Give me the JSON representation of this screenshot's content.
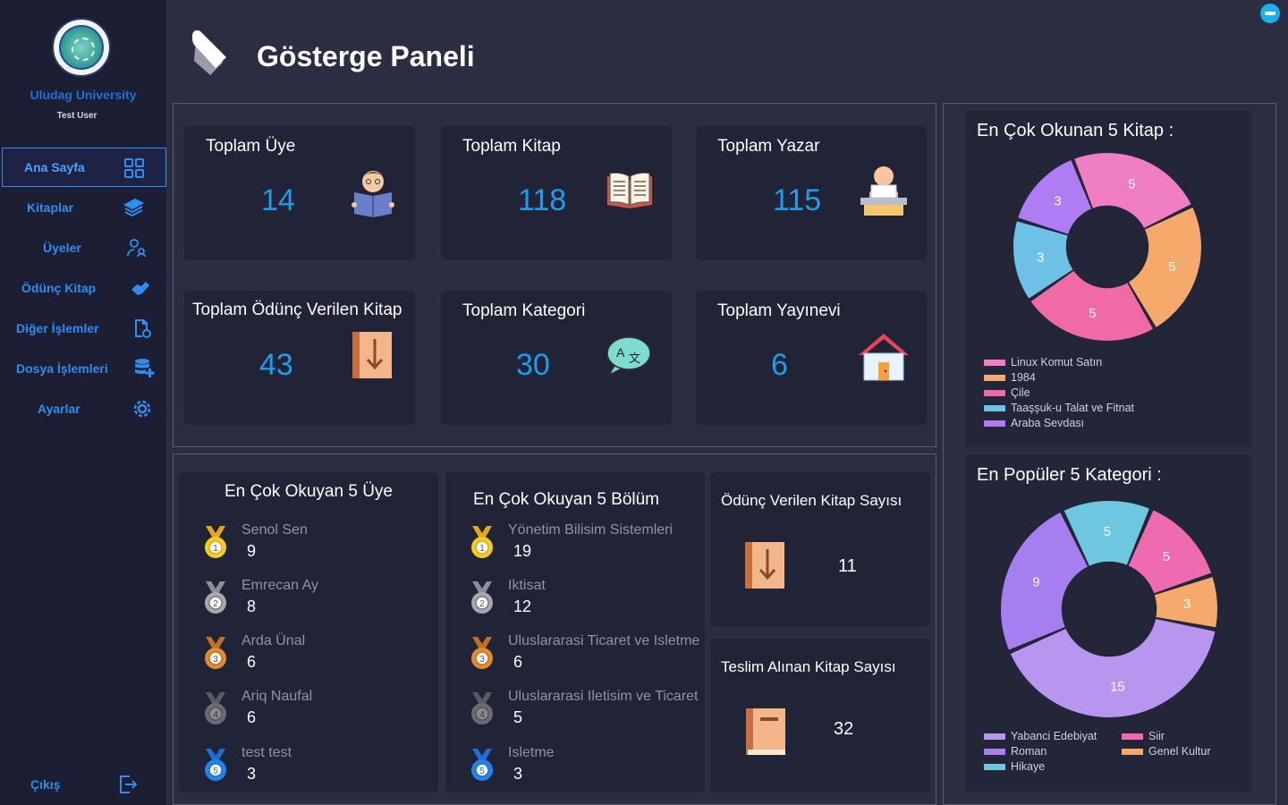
{
  "sidebar": {
    "university": "Uludag University",
    "user": "Test User",
    "items": [
      {
        "label": "Ana Sayfa"
      },
      {
        "label": "Kitaplar"
      },
      {
        "label": "Üyeler"
      },
      {
        "label": "Ödünç Kitap"
      },
      {
        "label": "Diğer İşlemler"
      },
      {
        "label": "Dosya İşlemleri"
      },
      {
        "label": "Ayarlar"
      }
    ],
    "exit_label": "Çıkış"
  },
  "header": {
    "title": "Gösterge Paneli"
  },
  "stats": [
    {
      "title": "Toplam Üye",
      "value": "14",
      "icon": "reader-icon"
    },
    {
      "title": "Toplam Kitap",
      "value": "118",
      "icon": "open-book-icon"
    },
    {
      "title": "Toplam Yazar",
      "value": "115",
      "icon": "writer-icon"
    },
    {
      "title": "Toplam Ödünç Verilen Kitap",
      "value": "43",
      "icon": "download-book-icon"
    },
    {
      "title": "Toplam Kategori",
      "value": "30",
      "icon": "translate-icon"
    },
    {
      "title": "Toplam Yayınevi",
      "value": "6",
      "icon": "house-icon"
    }
  ],
  "top_members": {
    "title": "En Çok Okuyan 5 Üye",
    "items": [
      {
        "name": "Senol Sen",
        "value": "9"
      },
      {
        "name": "Emrecan Ay",
        "value": "8"
      },
      {
        "name": "Arda Ünal",
        "value": "6"
      },
      {
        "name": "Ariq Naufal",
        "value": "6"
      },
      {
        "name": "test test",
        "value": "3"
      }
    ]
  },
  "top_departments": {
    "title": "En Çok Okuyan 5 Bölüm",
    "items": [
      {
        "name": "Yönetim Bilisim Sistemleri",
        "value": "19"
      },
      {
        "name": "Iktisat",
        "value": "12"
      },
      {
        "name": "Uluslararasi Ticaret ve Isletme",
        "value": "6"
      },
      {
        "name": "Uluslararasi Iletisim ve Ticaret",
        "value": "5"
      },
      {
        "name": "Isletme",
        "value": "3"
      }
    ]
  },
  "lent": {
    "title": "Ödünç Verilen Kitap Sayısı",
    "value": "11"
  },
  "returned": {
    "title": "Teslim Alınan Kitap Sayısı",
    "value": "32"
  },
  "colors": {
    "accent": "#1f9bf0",
    "sidebar_bg": "#1c1e33",
    "page_bg": "#2b2e40",
    "card_bg": "#212436"
  },
  "chart_data": [
    {
      "type": "pie",
      "title": "En Çok Okunan 5 Kitap :",
      "labels": [
        "Linux Komut Satın",
        "1984",
        "Çile",
        "Taaşşuk-u Talat ve Fitnat",
        "Araba Sevdası"
      ],
      "values": [
        5,
        5,
        5,
        3,
        3
      ],
      "colors": [
        "#f07ec4",
        "#f5a96b",
        "#f06aa6",
        "#6fc0e6",
        "#b07cf4"
      ],
      "legend": "bottom-left"
    },
    {
      "type": "pie",
      "title": "En Popüler 5 Kategori :",
      "labels": [
        "Yabanci Edebiyat",
        "Roman",
        "Hikaye",
        "Siir",
        "Genel Kultur"
      ],
      "values": [
        15,
        9,
        5,
        5,
        3
      ],
      "colors": [
        "#b896f0",
        "#a77ef0",
        "#6cc7df",
        "#f06ab0",
        "#f5a96b"
      ],
      "legend": "bottom"
    }
  ]
}
